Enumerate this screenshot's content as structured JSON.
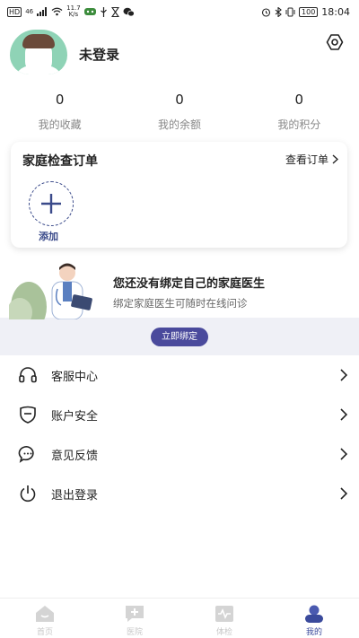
{
  "status_bar": {
    "left": [
      "HD",
      "46",
      "11.7",
      "K/s"
    ],
    "battery": "100",
    "time": "18:04"
  },
  "profile": {
    "name": "未登录"
  },
  "stats": [
    {
      "value": "0",
      "label": "我的收藏"
    },
    {
      "value": "0",
      "label": "我的余额"
    },
    {
      "value": "0",
      "label": "我的积分"
    }
  ],
  "orders": {
    "title": "家庭检查订单",
    "link": "查看订单",
    "add_label": "添加"
  },
  "doctor": {
    "title": "您还没有绑定自己的家庭医生",
    "subtitle": "绑定家庭医生可随时在线问诊",
    "button": "立即绑定"
  },
  "menu": [
    {
      "label": "客服中心",
      "icon": "headset-icon"
    },
    {
      "label": "账户安全",
      "icon": "shield-icon"
    },
    {
      "label": "意见反馈",
      "icon": "chat-bubble-icon"
    },
    {
      "label": "退出登录",
      "icon": "power-icon"
    }
  ],
  "nav": [
    {
      "label": "首页",
      "icon": "home-icon"
    },
    {
      "label": "医院",
      "icon": "hospital-icon"
    },
    {
      "label": "体检",
      "icon": "checkup-icon"
    },
    {
      "label": "我的",
      "icon": "profile-icon"
    }
  ],
  "colors": {
    "accent": "#4a4a9c",
    "avatar_bg": "#8fd3b6",
    "nav_active": "#3a4a9c",
    "nav_inactive": "#c8c8c8"
  }
}
